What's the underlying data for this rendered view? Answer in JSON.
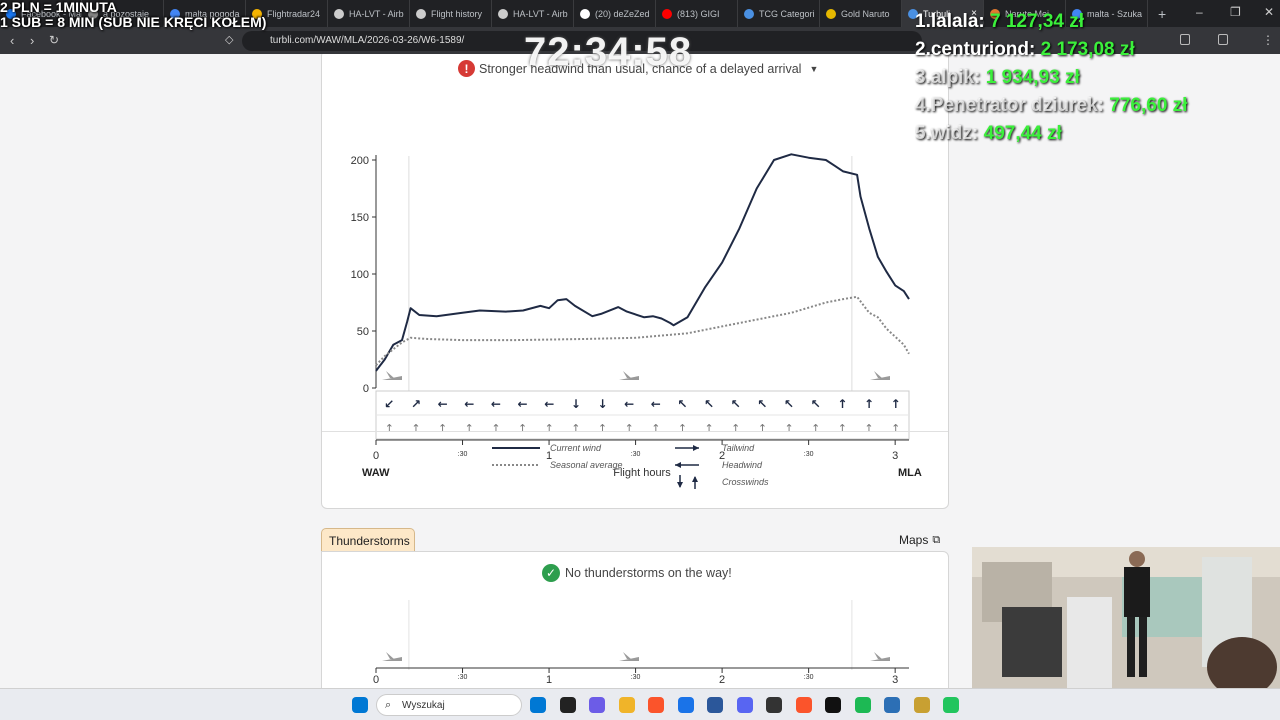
{
  "browser": {
    "tabs": [
      {
        "label": "Facebook - Ma...",
        "color": "#1877f2"
      },
      {
        "label": "ą pozostaje",
        "color": "#888888"
      },
      {
        "label": "malta pogoda",
        "color": "#4285f4"
      },
      {
        "label": "Flightradar24",
        "color": "#f5b400"
      },
      {
        "label": "HA-LVT - Airb",
        "color": "#cccccc"
      },
      {
        "label": "Flight history",
        "color": "#cccccc"
      },
      {
        "label": "HA-LVT - Airb",
        "color": "#cccccc"
      },
      {
        "label": "(20) deZeZed",
        "color": "#ffffff"
      },
      {
        "label": "(813) GIGI",
        "color": "#ff0000"
      },
      {
        "label": "TCG Categori",
        "color": "#4a90e2"
      },
      {
        "label": "Gold Naruto",
        "color": "#e6b800"
      },
      {
        "label": "Turbuli",
        "color": "#4a90e2",
        "active": true
      },
      {
        "label": "Naruto Mei",
        "color": "#e07a2f"
      },
      {
        "label": "malta - Szuka",
        "color": "#4285f4"
      }
    ],
    "new_tab": "+",
    "url": "turbli.com/WAW/MLA/2026-03-26/W6-1589/",
    "window_controls": [
      "–",
      "❐",
      "✕"
    ]
  },
  "wind": {
    "notice": "Stronger headwind than usual, chance of a delayed arrival",
    "x_label": "Flight hours",
    "origin": "WAW",
    "destination": "MLA",
    "legend": {
      "current": "Current wind",
      "seasonal": "Seasonal average",
      "tailwind": "Tailwind",
      "headwind": "Headwind",
      "crosswinds": "Crosswinds"
    }
  },
  "chart_data": {
    "type": "line",
    "xlabel": "Flight hours",
    "ylabel": "",
    "xlim": [
      0,
      3.08
    ],
    "ylim": [
      0,
      200
    ],
    "y_ticks": [
      0,
      50,
      100,
      150,
      200
    ],
    "x_ticks": [
      "0",
      ":30",
      "1",
      ":30",
      "2",
      ":30",
      "3"
    ],
    "series": [
      {
        "name": "Current wind",
        "x": [
          0,
          0.05,
          0.1,
          0.15,
          0.18,
          0.2,
          0.25,
          0.35,
          0.5,
          0.6,
          0.75,
          0.85,
          0.95,
          1.0,
          1.05,
          1.1,
          1.15,
          1.25,
          1.3,
          1.4,
          1.45,
          1.55,
          1.6,
          1.65,
          1.7,
          1.72,
          1.8,
          1.9,
          2.0,
          2.1,
          2.2,
          2.3,
          2.4,
          2.5,
          2.6,
          2.65,
          2.7,
          2.78,
          2.8,
          2.85,
          2.9,
          2.95,
          3.0,
          3.05,
          3.08
        ],
        "values": [
          15,
          25,
          38,
          42,
          58,
          70,
          64,
          63,
          66,
          68,
          67,
          68,
          72,
          70,
          77,
          78,
          72,
          63,
          65,
          71,
          67,
          62,
          63,
          61,
          57,
          55,
          62,
          88,
          110,
          140,
          175,
          200,
          205,
          202,
          200,
          195,
          190,
          187,
          168,
          140,
          115,
          102,
          90,
          85,
          78
        ]
      },
      {
        "name": "Seasonal average",
        "x": [
          0,
          0.05,
          0.1,
          0.15,
          0.2,
          0.3,
          0.5,
          0.8,
          1.2,
          1.5,
          1.8,
          2.0,
          2.2,
          2.4,
          2.6,
          2.7,
          2.78,
          2.85,
          2.9,
          2.95,
          3.0,
          3.05,
          3.08
        ],
        "values": [
          20,
          28,
          34,
          40,
          44,
          43,
          42,
          42,
          43,
          44,
          48,
          54,
          60,
          66,
          75,
          78,
          80,
          66,
          62,
          52,
          45,
          38,
          30
        ]
      }
    ],
    "headwind_arrows": [
      "↙",
      "↗",
      "←",
      "←",
      "←",
      "←",
      "←",
      "↓",
      "↓",
      "←",
      "←",
      "↖",
      "↖",
      "↖",
      "↖",
      "↖",
      "↖",
      "↑",
      "↑",
      "↑"
    ],
    "crosswind_arrows": [
      "↑",
      "↑",
      "↑",
      "↑",
      "↑",
      "↑",
      "↑",
      "↑",
      "↑",
      "↑",
      "↑",
      "↑",
      "↑",
      "↑",
      "↑",
      "↑",
      "↑",
      "↑",
      "↑",
      "↑"
    ]
  },
  "thunderstorms": {
    "tab_label": "Thunderstorms",
    "maps_label": "Maps",
    "notice": "No thunderstorms on the way!",
    "x_ticks": [
      "0",
      ":30",
      "1",
      ":30",
      "2",
      ":30",
      "3"
    ]
  },
  "stream_overlay": {
    "line1": "2 PLN = 1MINUTA",
    "line2": "1 SUB = 8 MIN (SUB NIE KRĘCI KOŁEM)",
    "timer": "72:34:58",
    "donors": [
      {
        "rank": "1.",
        "name": "lalala:",
        "amount": "7 127,34 zł"
      },
      {
        "rank": "2.",
        "name": "centuriond:",
        "amount": "2 173,08 zł"
      },
      {
        "rank": "3.",
        "name": "alpik:",
        "amount": "1 934,93 zł"
      },
      {
        "rank": "4.",
        "name": "Penetrator dziurek:",
        "amount": "776,60 zł"
      },
      {
        "rank": "5.",
        "name": "widz:",
        "amount": "497,44 zł"
      }
    ]
  },
  "taskbar": {
    "search_placeholder": "Wyszukaj",
    "apps": [
      "#0078d4",
      "#222222",
      "#6c5ce7",
      "#f0b429",
      "#fb542b",
      "#1a73e8",
      "#2b579a",
      "#5865f2",
      "#333333",
      "#fb542b",
      "#111111",
      "#1db954",
      "#2c6fb5",
      "#c8a032",
      "#22c55e"
    ]
  }
}
